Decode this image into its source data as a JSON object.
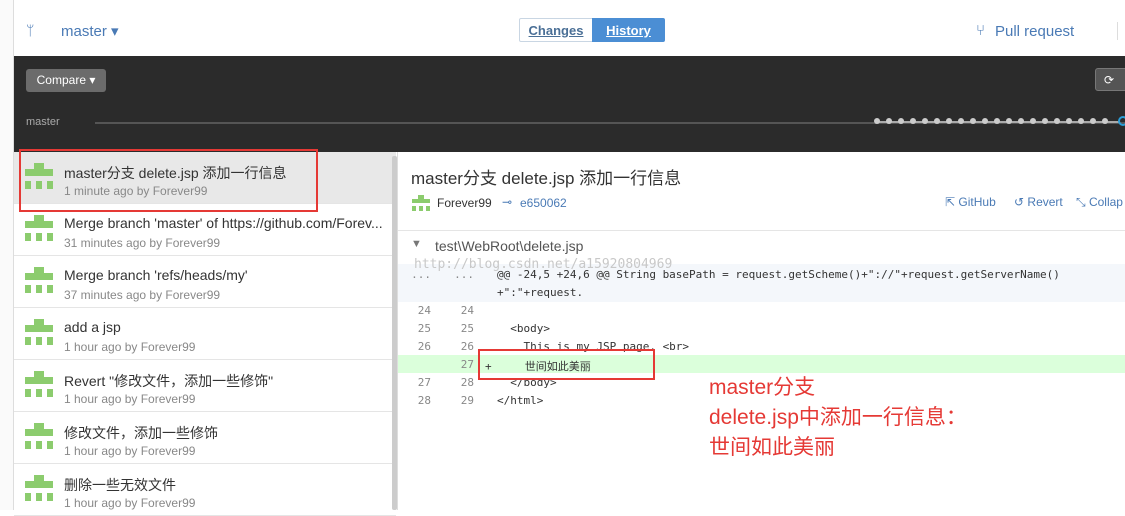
{
  "toolbar": {
    "branch": "master",
    "tabs": [
      {
        "label": "Changes"
      },
      {
        "label": "History"
      }
    ],
    "pull_request": "Pull request",
    "compare": "Compare",
    "timeline_label": "master"
  },
  "history": [
    {
      "title": "master分支  delete.jsp  添加一行信息",
      "meta": "1 minute ago by Forever99"
    },
    {
      "title": "Merge branch 'master' of https://github.com/Forev...",
      "meta": "31 minutes ago by Forever99"
    },
    {
      "title": "Merge branch 'refs/heads/my'",
      "meta": "37 minutes ago by Forever99"
    },
    {
      "title": "add  a jsp",
      "meta": "1 hour ago by Forever99"
    },
    {
      "title": "Revert \"修改文件，添加一些修饰\"",
      "meta": "1 hour ago by Forever99"
    },
    {
      "title": "修改文件，添加一些修饰",
      "meta": "1 hour ago by Forever99"
    },
    {
      "title": "删除一些无效文件",
      "meta": "1 hour ago by Forever99"
    }
  ],
  "commit": {
    "title": "master分支  delete.jsp  添加一行信息",
    "author": "Forever99",
    "sha": "e650062",
    "actions": {
      "github": "GitHub",
      "revert": "Revert",
      "collapse": "Collap"
    }
  },
  "file": {
    "path": "test\\WebRoot\\delete.jsp"
  },
  "watermark": "http://blog.csdn.net/a15920804969",
  "diff": {
    "hunk_dots": "...",
    "hunk_line1": "@@ -24,5 +24,6 @@ String basePath = request.getScheme()+\"://\"+request.getServerName()",
    "hunk_line2": "+\":\"+request.",
    "lines": [
      {
        "old": "24",
        "new": "24",
        "text": ""
      },
      {
        "old": "25",
        "new": "25",
        "text": "  <body>"
      },
      {
        "old": "26",
        "new": "26",
        "text": "    This is my JSP page. <br>"
      },
      {
        "old": "",
        "new": "27",
        "text": "+     世间如此美丽"
      },
      {
        "old": "27",
        "new": "28",
        "text": "  </body>"
      },
      {
        "old": "28",
        "new": "29",
        "text": "</html>"
      }
    ]
  },
  "annotation": {
    "line1": "master分支",
    "line2": "delete.jsp中添加一行信息：",
    "line3": "世间如此美丽"
  }
}
